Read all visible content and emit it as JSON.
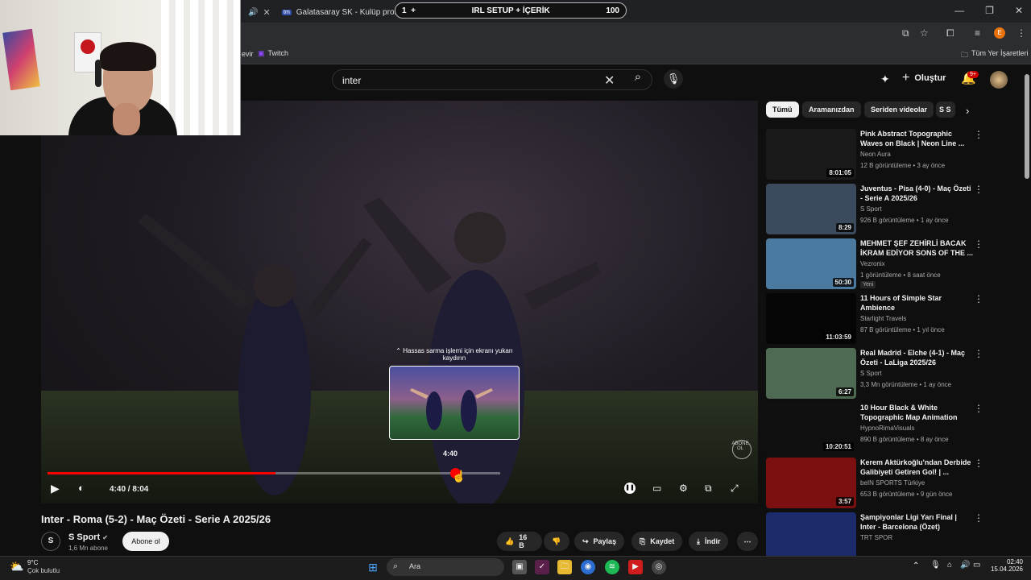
{
  "browser": {
    "tabs": [
      {
        "label": "Galatasaray SK - Kulüp profili |"
      },
      {
        "label": "IRL SETUP + İÇERİK",
        "count": "100"
      }
    ],
    "bookmarks": [
      "Twitch"
    ],
    "all_bookmarks": "Tüm Yer İşaretleri"
  },
  "youtube": {
    "search_value": "inter",
    "create_label": "Oluştur",
    "notif_badge": "9+"
  },
  "player": {
    "hint": "Hassas sarma işlemi için ekranı yukarı kaydırın",
    "preview_time": "4:40",
    "time": "4:40 / 8:04",
    "progress_fraction": 0.579,
    "buffered_fraction": 0.7,
    "watermark": "ABONE OL"
  },
  "video": {
    "title": "Inter - Roma (5-2) - Maç Özeti - Serie A 2025/26",
    "channel": "S Sport",
    "subscribers": "1,6 Mn abone",
    "subscribe_label": "Abone ol",
    "likes": "16 B",
    "share": "Paylaş",
    "save": "Kaydet",
    "download": "İndir"
  },
  "chips": [
    "Tümü",
    "Aramanızdan",
    "Seriden videolar",
    "S S"
  ],
  "recommendations": [
    {
      "title": "Pink Abstract Topographic Waves on Black | Neon Line ...",
      "channel": "Neon Aura",
      "meta": "12 B görüntüleme • 3 ay önce",
      "duration": "8:01:05",
      "color": "#1a1a1a"
    },
    {
      "title": "Juventus - Pisa (4-0) - Maç Özeti - Serie A 2025/26",
      "channel": "S Sport",
      "meta": "926 B görüntüleme • 1 ay önce",
      "duration": "8:29",
      "color": "#3b4a5c"
    },
    {
      "title": "MEHMET ŞEF ZEHİRLİ BACAK İKRAM EDİYOR SONS OF THE ...",
      "channel": "Vezronix",
      "meta": "1 görüntüleme • 8 saat önce",
      "duration": "50:30",
      "new": "Yeni",
      "color": "#4a7aa0"
    },
    {
      "title": "11 Hours of Simple Star Ambience",
      "channel": "Starlight Travels",
      "meta": "87 B görüntüleme • 1 yıl önce",
      "duration": "11:03:59",
      "color": "#050505"
    },
    {
      "title": "Real Madrid - Elche (4-1) - Maç Özeti - LaLiga 2025/26",
      "channel": "S Sport",
      "meta": "3,3 Mn görüntüleme • 1 ay önce",
      "duration": "6:27",
      "color": "#4f6a52"
    },
    {
      "title": "10 Hour Black & White Topographic Map Animation",
      "channel": "HypnoRimaVisuals",
      "meta": "890 B görüntüleme • 8 ay önce",
      "duration": "10:20:51",
      "color": "#101010"
    },
    {
      "title": "Kerem Aktürkoğlu'ndan Derbide Galibiyeti Getiren Gol! | ...",
      "channel": "beIN SPORTS Türkiye",
      "meta": "653 B görüntüleme • 9 gün önce",
      "duration": "3:57",
      "color": "#7a1010"
    },
    {
      "title": "Şampiyonlar Ligi Yarı Final | Inter - Barcelona (Özet)",
      "channel": "TRT SPOR",
      "meta": "",
      "duration": "",
      "color": "#1b2a6a"
    }
  ],
  "taskbar": {
    "weather_temp": "9°C",
    "weather_desc": "Çok bulutlu",
    "search": "Ara",
    "time": "02:40",
    "date": "15.04.2026"
  }
}
